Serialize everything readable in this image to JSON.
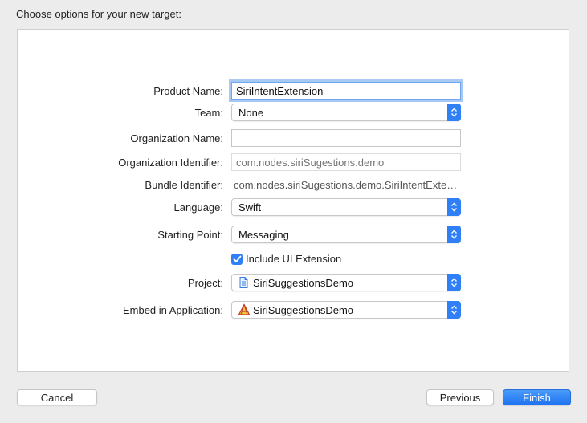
{
  "dialog": {
    "title": "Choose options for your new target:"
  },
  "form": {
    "product_name": {
      "label": "Product Name:",
      "value": "SiriIntentExtension"
    },
    "team": {
      "label": "Team:",
      "value": "None"
    },
    "organization_name": {
      "label": "Organization Name:",
      "value": ""
    },
    "organization_identifier": {
      "label": "Organization Identifier:",
      "placeholder": "com.nodes.siriSugestions.demo"
    },
    "bundle_identifier": {
      "label": "Bundle Identifier:",
      "value": "com.nodes.siriSugestions.demo.SiriIntentExten…"
    },
    "language": {
      "label": "Language:",
      "value": "Swift"
    },
    "starting_point": {
      "label": "Starting Point:",
      "value": "Messaging"
    },
    "include_ui_extension": {
      "label": "Include UI Extension",
      "checked": true
    },
    "project": {
      "label": "Project:",
      "value": "SiriSuggestionsDemo",
      "icon": "project-file-icon"
    },
    "embed_in_application": {
      "label": "Embed in Application:",
      "value": "SiriSuggestionsDemo",
      "icon": "app-target-icon"
    }
  },
  "buttons": {
    "cancel": "Cancel",
    "previous": "Previous",
    "finish": "Finish"
  },
  "colors": {
    "accent": "#2f7ff6",
    "focus_ring": "#a9c9f5",
    "window_bg": "#ececec"
  }
}
